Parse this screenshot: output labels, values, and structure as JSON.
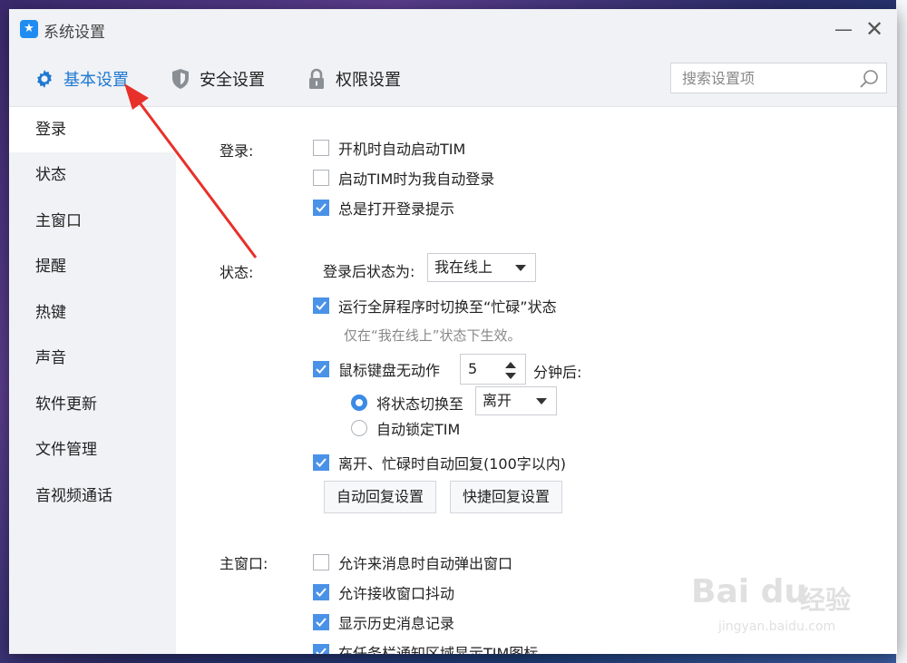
{
  "window": {
    "title": "系统设置",
    "minimize_glyph": "—",
    "close_glyph": "✕"
  },
  "tabs": [
    {
      "label": "基本设置",
      "icon": "gear-icon",
      "active": true
    },
    {
      "label": "安全设置",
      "icon": "shield-icon",
      "active": false
    },
    {
      "label": "权限设置",
      "icon": "lock-icon",
      "active": false
    }
  ],
  "search": {
    "placeholder": "搜索设置项",
    "value": ""
  },
  "sidebar": {
    "items": [
      {
        "label": "登录",
        "active": true
      },
      {
        "label": "状态",
        "active": false
      },
      {
        "label": "主窗口",
        "active": false
      },
      {
        "label": "提醒",
        "active": false
      },
      {
        "label": "热键",
        "active": false
      },
      {
        "label": "声音",
        "active": false
      },
      {
        "label": "软件更新",
        "active": false
      },
      {
        "label": "文件管理",
        "active": false
      },
      {
        "label": "音视频通话",
        "active": false
      }
    ]
  },
  "login_section": {
    "label": "登录:",
    "options": [
      {
        "label": "开机时自动启动TIM",
        "checked": false
      },
      {
        "label": "启动TIM时为我自动登录",
        "checked": false
      },
      {
        "label": "总是打开登录提示",
        "checked": true
      }
    ]
  },
  "status_section": {
    "label": "状态:",
    "after_login_label": "登录后状态为:",
    "after_login_value": "我在线上",
    "fullscreen_label": "运行全屏程序时切换至“忙碌”状态",
    "fullscreen_checked": true,
    "fullscreen_hint": "仅在“我在线上”状态下生效。",
    "idle_label": "鼠标键盘无动作",
    "idle_checked": true,
    "idle_minutes": "5",
    "idle_suffix": "分钟后:",
    "switch_label": "将状态切换至",
    "switch_selected": true,
    "switch_value": "离开",
    "lock_label": "自动锁定TIM",
    "lock_selected": false,
    "auto_reply_label": "离开、忙碌时自动回复(100字以内)",
    "auto_reply_checked": true,
    "auto_reply_button": "自动回复设置",
    "quick_reply_button": "快捷回复设置"
  },
  "main_window_section": {
    "label": "主窗口:",
    "options": [
      {
        "label": "允许来消息时自动弹出窗口",
        "checked": false
      },
      {
        "label": "允许接收窗口抖动",
        "checked": true
      },
      {
        "label": "显示历史消息记录",
        "checked": true
      },
      {
        "label": "在任务栏通知区域显示TIM图标",
        "checked": true
      }
    ]
  },
  "watermark": {
    "brand": "Bai du",
    "cn": "经验",
    "url": "jingyan.baidu.com"
  },
  "colors": {
    "accent": "#1e78d2",
    "checkbox_on": "#4a92e8",
    "annotation_arrow": "#e8302a"
  }
}
